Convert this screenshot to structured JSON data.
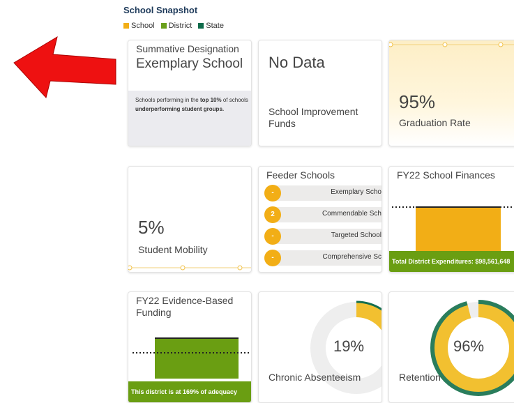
{
  "header": {
    "title": "School Snapshot",
    "legend": [
      {
        "label": "School",
        "color": "#f2ae16"
      },
      {
        "label": "District",
        "color": "#6aa01c"
      },
      {
        "label": "State",
        "color": "#0f6b4a"
      }
    ]
  },
  "cards": {
    "summative": {
      "label": "Summative Designation",
      "value": "Exemplary School",
      "description_prefix": "Schools performing in the ",
      "description_bold": "top 10%",
      "description_suffix": " of schools",
      "description_line2": "underperforming student groups."
    },
    "improvement": {
      "value": "No Data",
      "label_line1": "School Improvement",
      "label_line2": "Funds"
    },
    "graduation": {
      "value": "95%",
      "label": "Graduation Rate"
    },
    "mobility": {
      "value": "5%",
      "label": "Student Mobility"
    },
    "feeder": {
      "label": "Feeder Schools",
      "rows": [
        {
          "count": "-",
          "name": "Exemplary Scho"
        },
        {
          "count": "2",
          "name": "Commendable Sch"
        },
        {
          "count": "-",
          "name": "Targeted School"
        },
        {
          "count": "-",
          "name": "Comprehensive Sc"
        }
      ]
    },
    "finances": {
      "label": "FY22 School Finances",
      "footer": "Total District Expenditures: $98,561,648"
    },
    "ebf": {
      "label_line1": "FY22 Evidence-Based",
      "label_line2": "Funding",
      "footer": "This district is at 169% of adequacy"
    },
    "absenteeism": {
      "value": "19%",
      "label": "Chronic Absenteeism",
      "percent": 19
    },
    "retention": {
      "value": "96%",
      "label": "Retention",
      "percent": 96
    }
  },
  "annotation": {
    "arrow_color": "#ee1111"
  }
}
